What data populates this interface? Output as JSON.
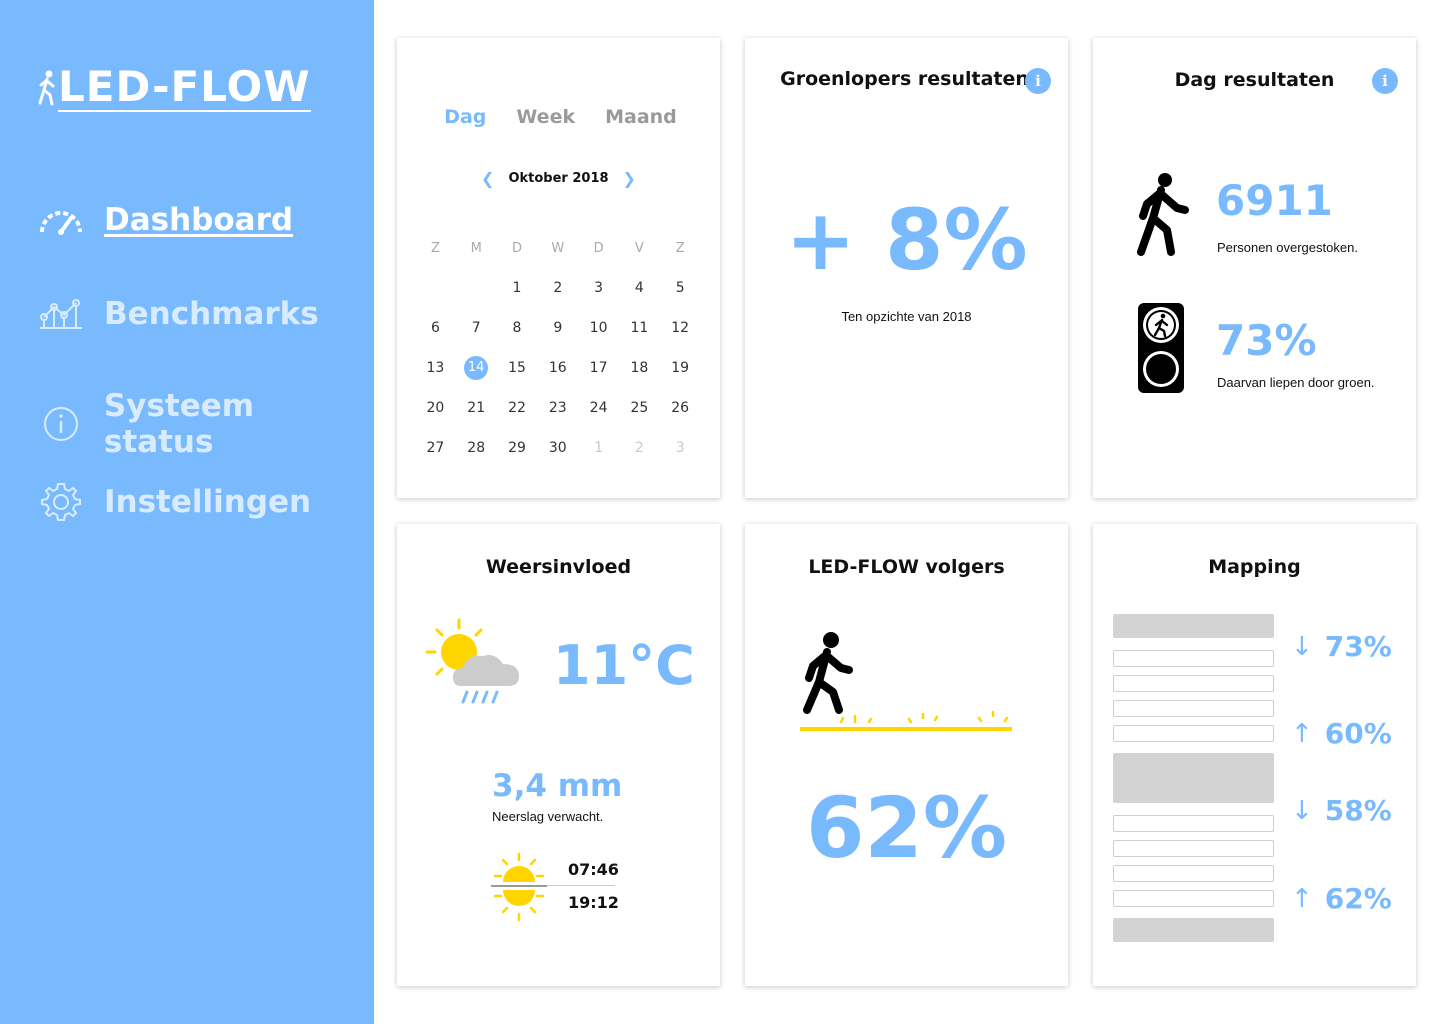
{
  "app": {
    "name": "LED-FLOW"
  },
  "nav": [
    {
      "label": "Dashboard",
      "icon": "speedometer-icon",
      "active": true
    },
    {
      "label": "Benchmarks",
      "icon": "line-chart-icon",
      "active": false
    },
    {
      "label": "Systeem status",
      "icon": "info-circle-icon",
      "active": false
    },
    {
      "label": "Instellingen",
      "icon": "gear-icon",
      "active": false
    }
  ],
  "calendar": {
    "tabs": [
      "Dag",
      "Week",
      "Maand"
    ],
    "active_tab": "Dag",
    "month_label": "Oktober 2018",
    "weekdays": [
      "Z",
      "M",
      "D",
      "W",
      "D",
      "V",
      "Z"
    ],
    "weeks": [
      [
        "",
        "",
        "1",
        "2",
        "3",
        "4",
        "5"
      ],
      [
        "6",
        "7",
        "8",
        "9",
        "10",
        "11",
        "12"
      ],
      [
        "13",
        "14",
        "15",
        "16",
        "17",
        "18",
        "19"
      ],
      [
        "20",
        "21",
        "22",
        "23",
        "24",
        "25",
        "26"
      ],
      [
        "27",
        "28",
        "29",
        "30",
        "1",
        "2",
        "3"
      ]
    ],
    "selected_day": "14"
  },
  "groenlopers": {
    "title": "Groenlopers resultaten",
    "value": "+ 8%",
    "caption": "Ten opzichte van 2018"
  },
  "dag": {
    "title": "Dag resultaten",
    "persons_value": "6911",
    "persons_caption": "Personen overgestoken.",
    "green_value": "73%",
    "green_caption": "Daarvan liepen door groen."
  },
  "weer": {
    "title": "Weersinvloed",
    "temperature": "11°C",
    "rain_value": "3,4 mm",
    "rain_caption": "Neerslag verwacht.",
    "sunrise": "07:46",
    "sunset": "19:12"
  },
  "volgers": {
    "title": "LED-FLOW volgers",
    "value": "62%"
  },
  "mapping": {
    "title": "Mapping",
    "stats": [
      {
        "direction": "down",
        "arrow": "↓",
        "value": "73%"
      },
      {
        "direction": "up",
        "arrow": "↑",
        "value": "60%"
      },
      {
        "direction": "down",
        "arrow": "↓",
        "value": "58%"
      },
      {
        "direction": "up",
        "arrow": "↑",
        "value": "62%"
      }
    ]
  },
  "colors": {
    "accent": "#79baff",
    "sidebar": "#79baff",
    "sun": "#ffd500",
    "rain_cloud": "#cccccc"
  }
}
